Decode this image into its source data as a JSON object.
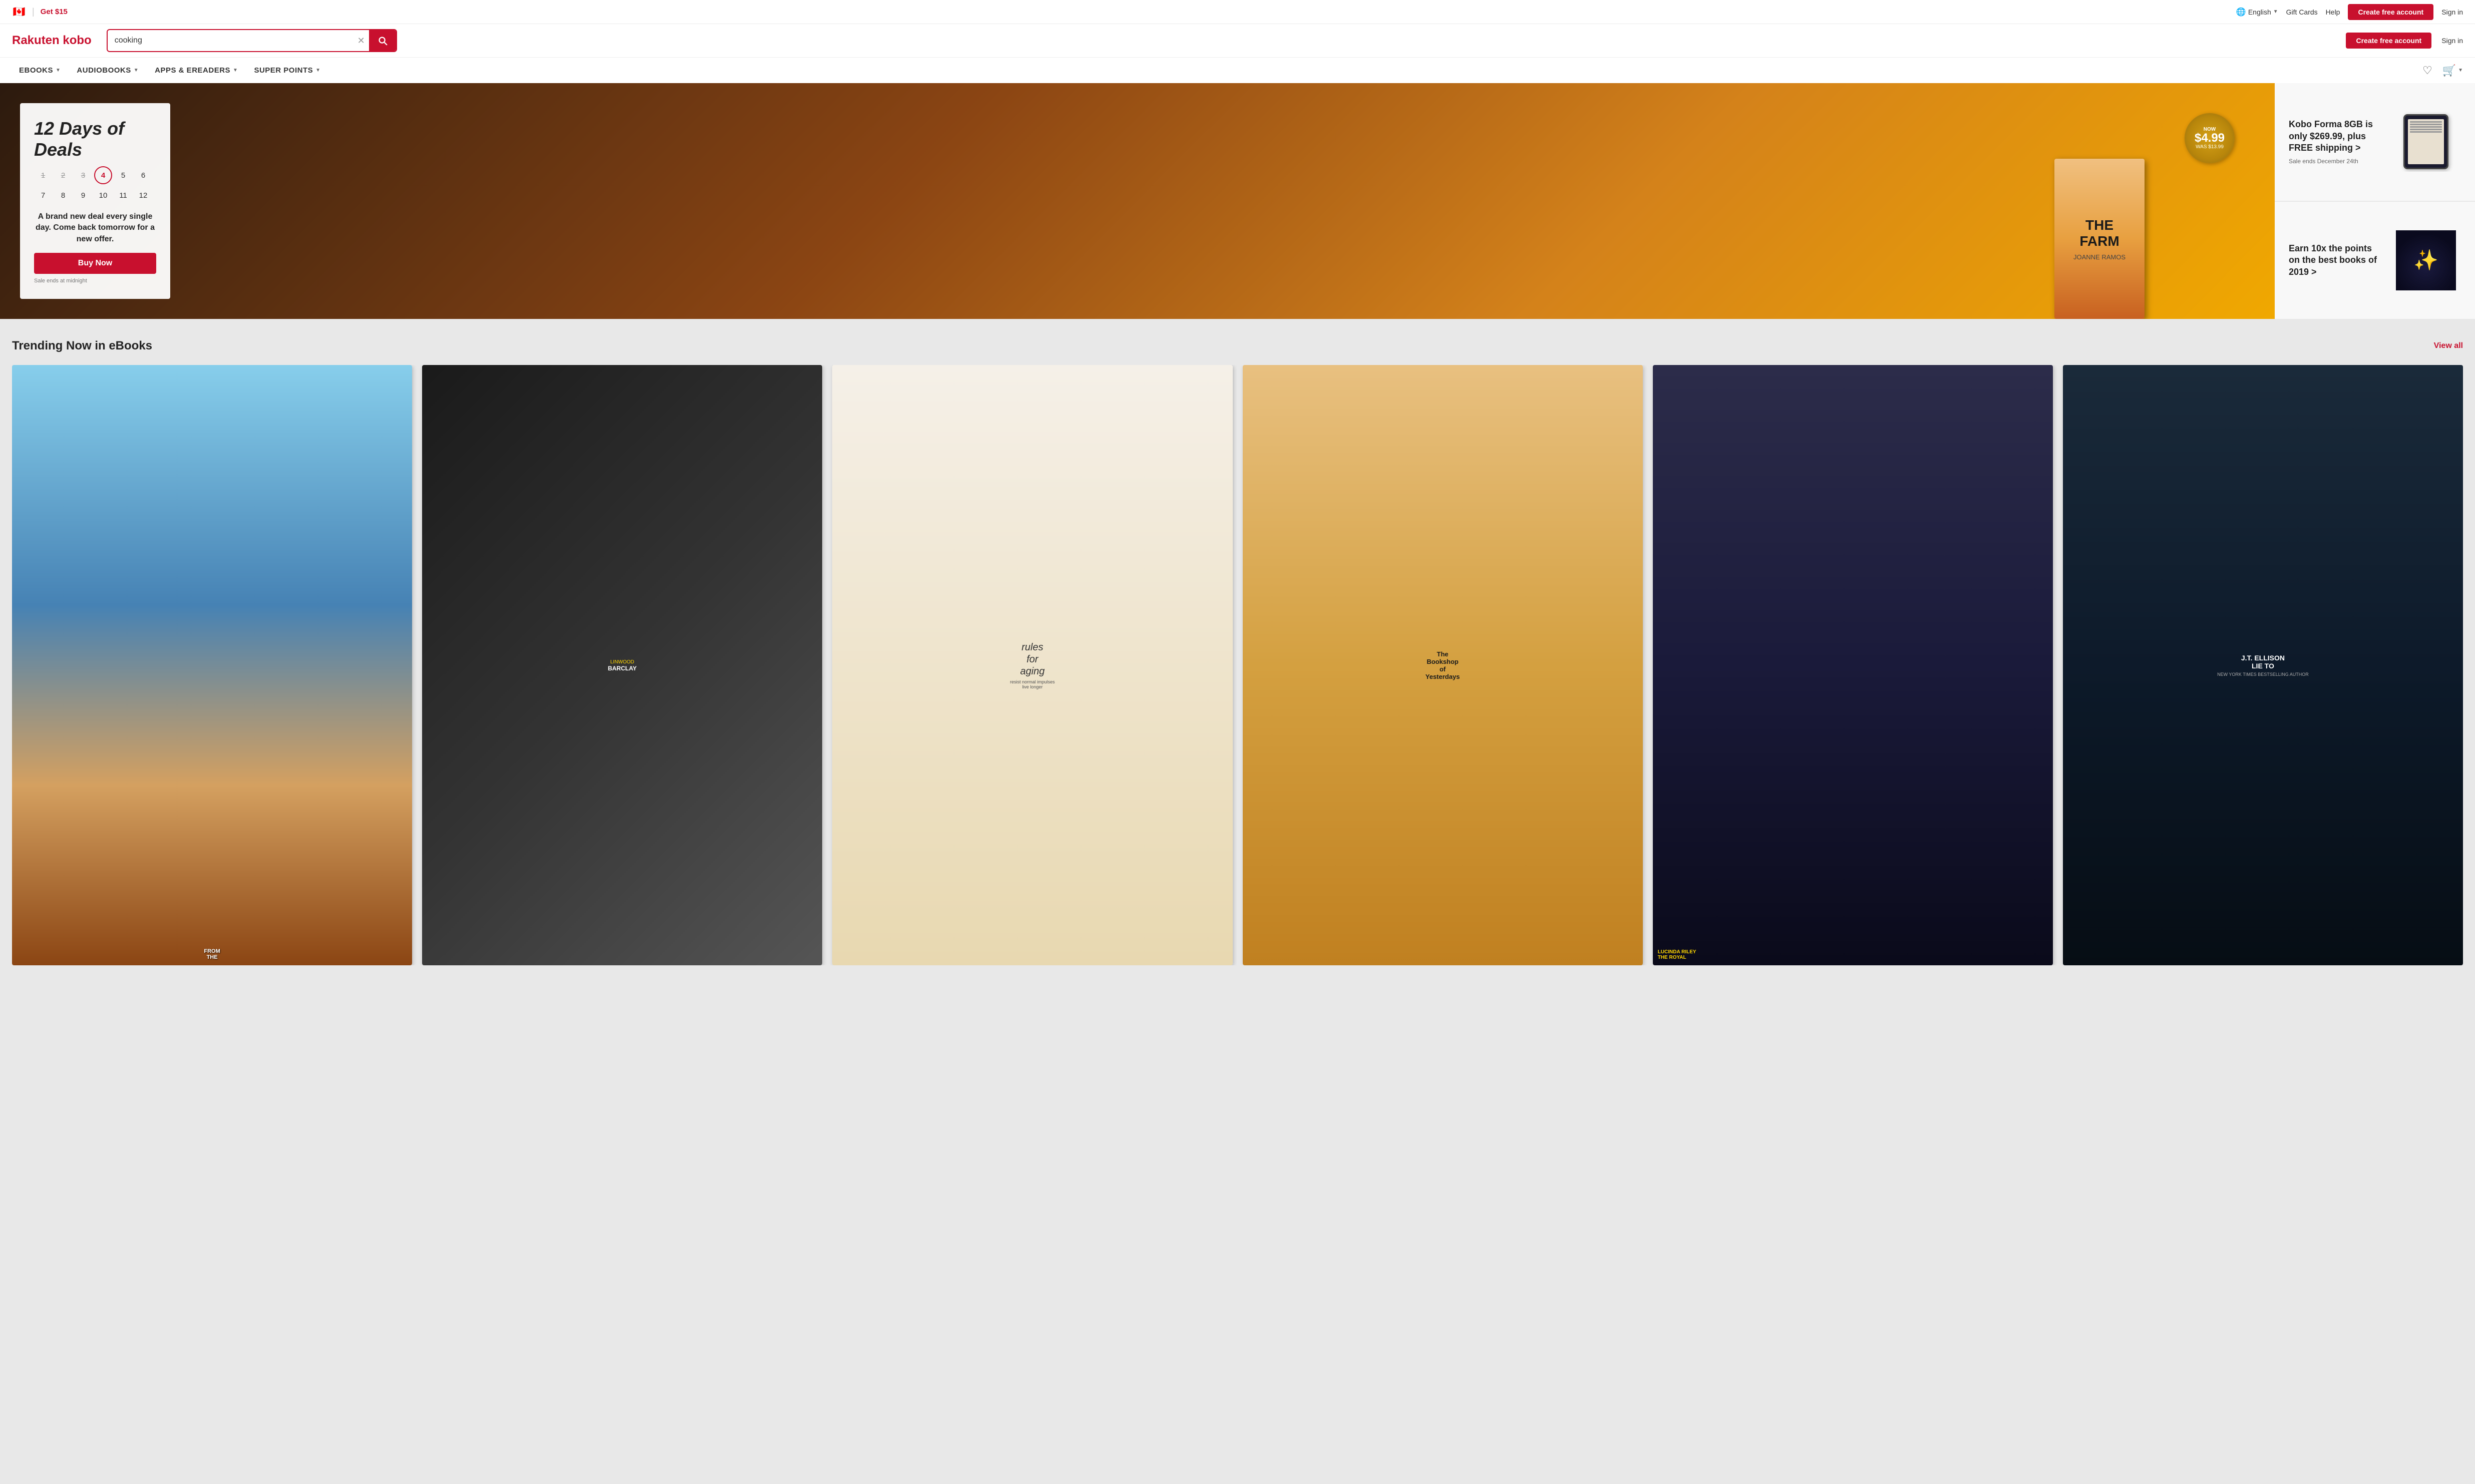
{
  "topbar": {
    "get15_label": "Get $15",
    "language_label": "English",
    "gift_cards_label": "Gift Cards",
    "help_label": "Help",
    "create_account_label": "Create free account",
    "sign_in_label": "Sign in"
  },
  "header": {
    "logo": "Rakuten kobo",
    "search_placeholder": "cooking",
    "search_value": "cooking"
  },
  "nav": {
    "items": [
      {
        "label": "eBOOKS"
      },
      {
        "label": "AUDIOBOOKS"
      },
      {
        "label": "APPS & eREADERS"
      },
      {
        "label": "SUPER POINTS"
      }
    ]
  },
  "main_banner": {
    "title": "12 Days of Deals",
    "days": [
      "1",
      "2",
      "3",
      "4",
      "5",
      "6",
      "7",
      "8",
      "9",
      "10",
      "11",
      "12"
    ],
    "description": "A brand new deal every single day. Come back tomorrow for a new offer.",
    "buy_now_label": "Buy Now",
    "sale_note": "Sale ends at midnight",
    "price_now_label": "NOW",
    "price_amount": "$4.99",
    "price_was": "WAS $13.99",
    "book_title": "THE FARM",
    "book_author": "JOANNE RAMOS"
  },
  "side_banners": {
    "banner1": {
      "title": "Kobo Forma 8GB is only $269.99, plus FREE shipping >",
      "subtitle": "Sale ends December 24th"
    },
    "banner2": {
      "title": "Earn 10x the points on the best books of 2019 >",
      "subtitle": ""
    }
  },
  "trending": {
    "section_title": "Trending Now in eBooks",
    "view_all_label": "View all",
    "books": [
      {
        "title": "FROM THE",
        "author": ""
      },
      {
        "title": "LINWOOD BARCLAY",
        "author": "Linwood Barclay"
      },
      {
        "title": "rules for aging",
        "author": ""
      },
      {
        "title": "The Bookshop of Yesterdays",
        "author": ""
      },
      {
        "title": "LUCINDA RILEY",
        "author": "Lucinda Riley"
      },
      {
        "title": "J.T. ELLISON LIE TO",
        "author": "J.T. Ellison"
      }
    ]
  }
}
